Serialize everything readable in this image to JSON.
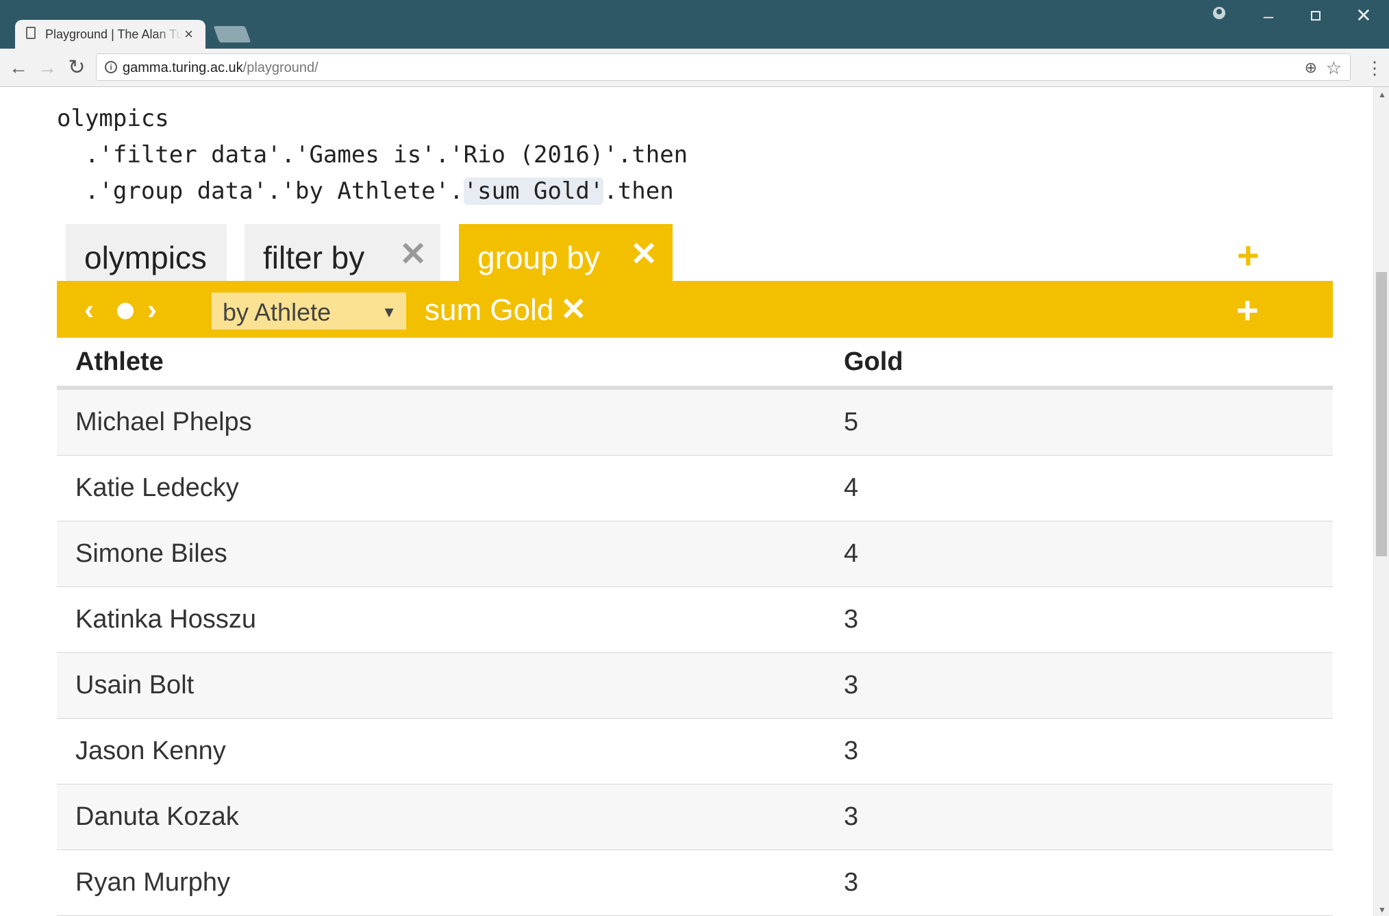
{
  "browser": {
    "tab_title": "Playground | The Alan Turing Institute",
    "tab_close": "×",
    "url_host": "gamma.turing.ac.uk",
    "url_path": "/playground/",
    "back": "←",
    "forward": "→",
    "reload": "↻",
    "minimize": "–",
    "close_window": "✕",
    "zoom": "⊕",
    "star": "☆",
    "menu": "⋮",
    "info": "i"
  },
  "code": {
    "line1": "olympics",
    "line2": "  .'filter data'.'Games is'.'Rio (2016)'.then",
    "line3_a": "  .'group data'.'by Athlete'.",
    "line3_hl": "'sum Gold'",
    "line3_b": ".then"
  },
  "tabs": [
    {
      "label": "olympics"
    },
    {
      "label": "filter by",
      "remove": "✕"
    },
    {
      "label": "group by",
      "remove": "✕"
    }
  ],
  "add_step": "+",
  "bar": {
    "prev": "‹",
    "next": "›",
    "select_value": "by Athlete",
    "select_caret": "▼",
    "aggregate": "sum Gold",
    "aggregate_remove": "✕",
    "add": "+"
  },
  "table": {
    "headers": [
      "Athlete",
      "Gold"
    ],
    "rows": [
      [
        "Michael Phelps",
        "5"
      ],
      [
        "Katie Ledecky",
        "4"
      ],
      [
        "Simone Biles",
        "4"
      ],
      [
        "Katinka Hosszu",
        "3"
      ],
      [
        "Usain Bolt",
        "3"
      ],
      [
        "Jason Kenny",
        "3"
      ],
      [
        "Danuta Kozak",
        "3"
      ],
      [
        "Ryan Murphy",
        "3"
      ]
    ]
  },
  "colors": {
    "accent": "#f2c000",
    "chrome": "#2e5866"
  }
}
